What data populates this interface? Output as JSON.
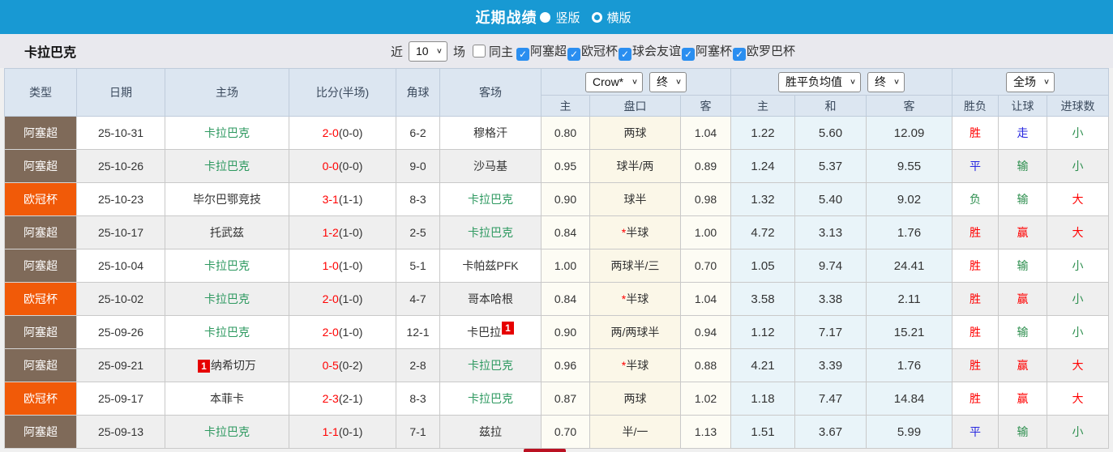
{
  "title_bar": {
    "title": "近期战绩",
    "layout_options": [
      {
        "label": "竖版",
        "selected": true
      },
      {
        "label": "横版",
        "selected": false
      }
    ]
  },
  "filter_bar": {
    "team_name": "卡拉巴克",
    "recent_label": "近",
    "recent_count": "10",
    "matches_label": "场",
    "same_home": {
      "label": "同主",
      "checked": false
    },
    "leagues": [
      {
        "label": "阿塞超",
        "checked": true
      },
      {
        "label": "欧冠杯",
        "checked": true
      },
      {
        "label": "球会友谊",
        "checked": true
      },
      {
        "label": "阿塞杯",
        "checked": true
      },
      {
        "label": "欧罗巴杯",
        "checked": true
      }
    ]
  },
  "table": {
    "main_headers": [
      "类型",
      "日期",
      "主场",
      "比分(半场)",
      "角球",
      "客场"
    ],
    "selects": {
      "odds_company": "Crow*",
      "odds_company_time": "终",
      "avg_type": "胜平负均值",
      "avg_time": "终",
      "scope": "全场"
    },
    "sub_headers": [
      "主",
      "盘口",
      "客",
      "主",
      "和",
      "客",
      "胜负",
      "让球",
      "进球数"
    ],
    "colors": {
      "brown": "#7f6a59",
      "orange": "#f15a08",
      "red": "#ff0000",
      "blue": "#2727e0",
      "green": "#2e8f4f",
      "team_green": "#2e9960"
    },
    "rows": [
      {
        "league": "阿塞超",
        "league_color": "brown",
        "date": "25-10-31",
        "home": "卡拉巴克",
        "home_green": true,
        "home_rank": "",
        "score": "2-0",
        "half": "(0-0)",
        "corners": "6-2",
        "away": "穆格汗",
        "away_green": false,
        "away_rank": "",
        "odds_home": "0.80",
        "handicap": "两球",
        "handicap_star": false,
        "odds_away": "1.04",
        "avg_home": "1.22",
        "avg_draw": "5.60",
        "avg_away": "12.09",
        "result": "胜",
        "result_color": "red",
        "let_result": "走",
        "let_color": "blue",
        "goals": "小",
        "goals_color": "green"
      },
      {
        "league": "阿塞超",
        "league_color": "brown",
        "date": "25-10-26",
        "home": "卡拉巴克",
        "home_green": true,
        "home_rank": "",
        "score": "0-0",
        "half": "(0-0)",
        "corners": "9-0",
        "away": "沙马基",
        "away_green": false,
        "away_rank": "",
        "odds_home": "0.95",
        "handicap": "球半/两",
        "handicap_star": false,
        "odds_away": "0.89",
        "avg_home": "1.24",
        "avg_draw": "5.37",
        "avg_away": "9.55",
        "result": "平",
        "result_color": "blue",
        "let_result": "输",
        "let_color": "green",
        "goals": "小",
        "goals_color": "green"
      },
      {
        "league": "欧冠杯",
        "league_color": "orange",
        "date": "25-10-23",
        "home": "毕尔巴鄂竞技",
        "home_green": false,
        "home_rank": "",
        "score": "3-1",
        "half": "(1-1)",
        "corners": "8-3",
        "away": "卡拉巴克",
        "away_green": true,
        "away_rank": "",
        "odds_home": "0.90",
        "handicap": "球半",
        "handicap_star": false,
        "odds_away": "0.98",
        "avg_home": "1.32",
        "avg_draw": "5.40",
        "avg_away": "9.02",
        "result": "负",
        "result_color": "green",
        "let_result": "输",
        "let_color": "green",
        "goals": "大",
        "goals_color": "red"
      },
      {
        "league": "阿塞超",
        "league_color": "brown",
        "date": "25-10-17",
        "home": "托武兹",
        "home_green": false,
        "home_rank": "",
        "score": "1-2",
        "half": "(1-0)",
        "corners": "2-5",
        "away": "卡拉巴克",
        "away_green": true,
        "away_rank": "",
        "odds_home": "0.84",
        "handicap": "半球",
        "handicap_star": true,
        "odds_away": "1.00",
        "avg_home": "4.72",
        "avg_draw": "3.13",
        "avg_away": "1.76",
        "result": "胜",
        "result_color": "red",
        "let_result": "赢",
        "let_color": "red",
        "goals": "大",
        "goals_color": "red"
      },
      {
        "league": "阿塞超",
        "league_color": "brown",
        "date": "25-10-04",
        "home": "卡拉巴克",
        "home_green": true,
        "home_rank": "",
        "score": "1-0",
        "half": "(1-0)",
        "corners": "5-1",
        "away": "卡帕兹PFK",
        "away_green": false,
        "away_rank": "",
        "odds_home": "1.00",
        "handicap": "两球半/三",
        "handicap_star": false,
        "odds_away": "0.70",
        "avg_home": "1.05",
        "avg_draw": "9.74",
        "avg_away": "24.41",
        "result": "胜",
        "result_color": "red",
        "let_result": "输",
        "let_color": "green",
        "goals": "小",
        "goals_color": "green"
      },
      {
        "league": "欧冠杯",
        "league_color": "orange",
        "date": "25-10-02",
        "home": "卡拉巴克",
        "home_green": true,
        "home_rank": "",
        "score": "2-0",
        "half": "(1-0)",
        "corners": "4-7",
        "away": "哥本哈根",
        "away_green": false,
        "away_rank": "",
        "odds_home": "0.84",
        "handicap": "半球",
        "handicap_star": true,
        "odds_away": "1.04",
        "avg_home": "3.58",
        "avg_draw": "3.38",
        "avg_away": "2.11",
        "result": "胜",
        "result_color": "red",
        "let_result": "赢",
        "let_color": "red",
        "goals": "小",
        "goals_color": "green"
      },
      {
        "league": "阿塞超",
        "league_color": "brown",
        "date": "25-09-26",
        "home": "卡拉巴克",
        "home_green": true,
        "home_rank": "",
        "score": "2-0",
        "half": "(1-0)",
        "corners": "12-1",
        "away": "卡巴拉",
        "away_green": false,
        "away_rank": "1",
        "odds_home": "0.90",
        "handicap": "两/两球半",
        "handicap_star": false,
        "odds_away": "0.94",
        "avg_home": "1.12",
        "avg_draw": "7.17",
        "avg_away": "15.21",
        "result": "胜",
        "result_color": "red",
        "let_result": "输",
        "let_color": "green",
        "goals": "小",
        "goals_color": "green"
      },
      {
        "league": "阿塞超",
        "league_color": "brown",
        "date": "25-09-21",
        "home": "纳希切万",
        "home_green": false,
        "home_rank": "1",
        "score": "0-5",
        "half": "(0-2)",
        "corners": "2-8",
        "away": "卡拉巴克",
        "away_green": true,
        "away_rank": "",
        "odds_home": "0.96",
        "handicap": "半球",
        "handicap_star": true,
        "odds_away": "0.88",
        "avg_home": "4.21",
        "avg_draw": "3.39",
        "avg_away": "1.76",
        "result": "胜",
        "result_color": "red",
        "let_result": "赢",
        "let_color": "red",
        "goals": "大",
        "goals_color": "red"
      },
      {
        "league": "欧冠杯",
        "league_color": "orange",
        "date": "25-09-17",
        "home": "本菲卡",
        "home_green": false,
        "home_rank": "",
        "score": "2-3",
        "half": "(2-1)",
        "corners": "8-3",
        "away": "卡拉巴克",
        "away_green": true,
        "away_rank": "",
        "odds_home": "0.87",
        "handicap": "两球",
        "handicap_star": false,
        "odds_away": "1.02",
        "avg_home": "1.18",
        "avg_draw": "7.47",
        "avg_away": "14.84",
        "result": "胜",
        "result_color": "red",
        "let_result": "赢",
        "let_color": "red",
        "goals": "大",
        "goals_color": "red"
      },
      {
        "league": "阿塞超",
        "league_color": "brown",
        "date": "25-09-13",
        "home": "卡拉巴克",
        "home_green": true,
        "home_rank": "",
        "score": "1-1",
        "half": "(0-1)",
        "corners": "7-1",
        "away": "兹拉",
        "away_green": false,
        "away_rank": "",
        "odds_home": "0.70",
        "handicap": "半/一",
        "handicap_star": false,
        "odds_away": "1.13",
        "avg_home": "1.51",
        "avg_draw": "3.67",
        "avg_away": "5.99",
        "result": "平",
        "result_color": "blue",
        "let_result": "输",
        "let_color": "green",
        "goals": "小",
        "goals_color": "green"
      }
    ]
  }
}
